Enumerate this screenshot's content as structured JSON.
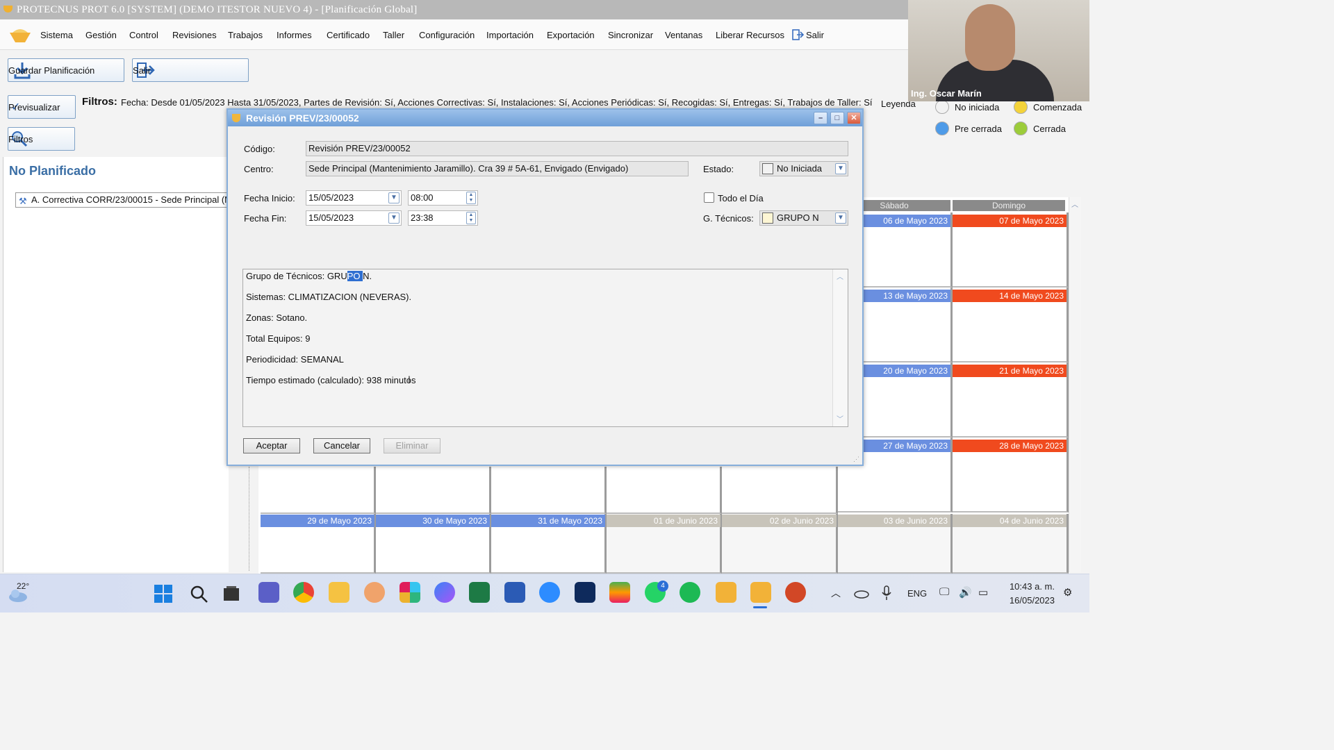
{
  "window": {
    "title": "PROTECNUS PROT 6.0 [SYSTEM] (DEMO ITESTOR NUEVO 4) - [Planificación Global]"
  },
  "menu": [
    "Sistema",
    "Gestión",
    "Control",
    "Revisiones",
    "Trabajos",
    "Informes",
    "Certificado",
    "Taller",
    "Configuración",
    "Importación",
    "Exportación",
    "Sincronizar",
    "Ventanas",
    "Liberar Recursos",
    "Salir"
  ],
  "toolbar": {
    "guardar": "Guardar Planificación",
    "salir": "Salir",
    "previsualizar": "Previsualizar",
    "filtros": "Filtros"
  },
  "filters": {
    "label": "Filtros:",
    "text": "Fecha: Desde 01/05/2023 Hasta 31/05/2023, Partes de Revisión: Sí, Acciones Correctivas: Sí, Instalaciones: Sí, Acciones Periódicas: Sí, Recogidas: Sí, Entregas: Sí, Trabajos de Taller: Sí"
  },
  "legend": {
    "title": "Leyenda",
    "items": [
      {
        "label": "No iniciada",
        "color": "#f2f2f2"
      },
      {
        "label": "Comenzada",
        "color": "#f4d33a"
      },
      {
        "label": "Pre cerrada",
        "color": "#4e9be8"
      },
      {
        "label": "Cerrada",
        "color": "#9ccc3a"
      }
    ]
  },
  "left_panel": {
    "title": "No Planificado",
    "item": "A. Correctiva CORR/23/00015 - Sede Principal (M"
  },
  "calendar": {
    "day_headers": [
      "Sábado",
      "Domingo"
    ],
    "rows": [
      [
        "06 de Mayo 2023",
        "07 de Mayo 2023"
      ],
      [
        "13 de Mayo 2023",
        "14 de Mayo 2023"
      ],
      [
        "20 de Mayo 2023",
        "21 de Mayo 2023"
      ],
      [
        "27 de Mayo 2023",
        "28 de Mayo 2023"
      ]
    ],
    "last_row": [
      "29 de Mayo 2023",
      "30 de Mayo 2023",
      "31 de Mayo 2023",
      "01 de Junio 2023",
      "02 de Junio 2023",
      "03 de Junio 2023",
      "04 de Junio 2023"
    ]
  },
  "webcam": {
    "name": "Ing. Oscar Marín"
  },
  "dialog": {
    "title": "Revisión PREV/23/00052",
    "codigo_label": "Código:",
    "codigo": "Revisión PREV/23/00052",
    "centro_label": "Centro:",
    "centro": "Sede Principal (Mantenimiento Jaramillo). Cra 39 # 5A-61,  Envigado (Envigado)",
    "estado_label": "Estado:",
    "estado": "No Iniciada",
    "fecha_inicio_label": "Fecha Inicio:",
    "fecha_inicio": "15/05/2023",
    "hora_inicio": "08:00",
    "fecha_fin_label": "Fecha Fin:",
    "fecha_fin": "15/05/2023",
    "hora_fin": "23:38",
    "todo_dia_label": "Todo el Día",
    "gtecnicos_label": "G. Técnicos:",
    "gtecnicos": "GRUPO N",
    "memo": {
      "line1_pre": "Grupo de Técnicos: GRU",
      "line1_sel": "PO ",
      "line1_post": "N.",
      "line2": "Sistemas: CLIMATIZACION (NEVERAS).",
      "line3": "Zonas: Sotano.",
      "line4": "Total Equipos: 9",
      "line5": "Periodicidad: SEMANAL",
      "line6": "Tiempo estimado (calculado): 938 minutos"
    },
    "aceptar": "Aceptar",
    "cancelar": "Cancelar",
    "eliminar": "Eliminar"
  },
  "taskbar": {
    "weather_temp": "22°",
    "whatsapp_badge": "4",
    "lang": "ENG",
    "time": "10:43 a. m.",
    "date": "16/05/2023",
    "icons": [
      "windows-start-icon",
      "search-icon",
      "task-view-icon",
      "chat-icon",
      "chrome-icon",
      "file-explorer-icon",
      "app-icon",
      "slack-icon",
      "copilot-icon",
      "excel-icon",
      "word-icon",
      "zoom-icon",
      "teamviewer-icon",
      "stack-icon",
      "whatsapp-icon",
      "spotify-icon",
      "protecnus-icon",
      "protecnus-active-icon",
      "powerpoint-icon"
    ]
  }
}
